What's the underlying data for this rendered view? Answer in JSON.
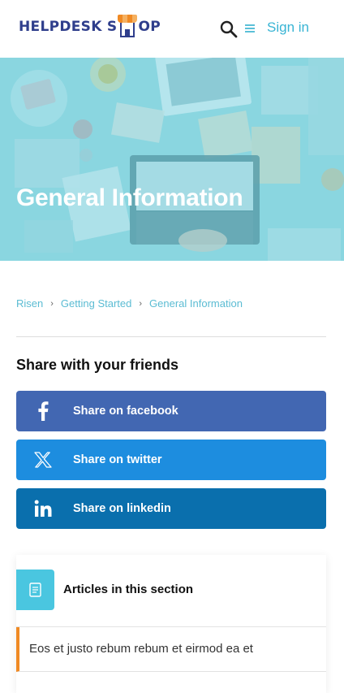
{
  "header": {
    "logo_left": "HELPDESK S",
    "logo_right": "OP",
    "signin_label": "Sign in"
  },
  "hero": {
    "title": "General Information"
  },
  "breadcrumb": [
    {
      "label": "Risen"
    },
    {
      "label": "Getting Started"
    },
    {
      "label": "General Information"
    }
  ],
  "share": {
    "title": "Share with your friends",
    "buttons": [
      {
        "label": "Share on facebook",
        "icon": "facebook-icon",
        "color": "#4267b2"
      },
      {
        "label": "Share on twitter",
        "icon": "x-twitter-icon",
        "color": "#1d8ddf"
      },
      {
        "label": "Share on linkedin",
        "icon": "linkedin-icon",
        "color": "#0a6fad"
      }
    ]
  },
  "articles": {
    "title": "Articles in this section",
    "items": [
      {
        "label": "Eos et justo rebum rebum et eirmod ea et"
      }
    ]
  },
  "colors": {
    "accent": "#38b4d4",
    "brand": "#2f3e8c",
    "orange": "#f08a24"
  }
}
